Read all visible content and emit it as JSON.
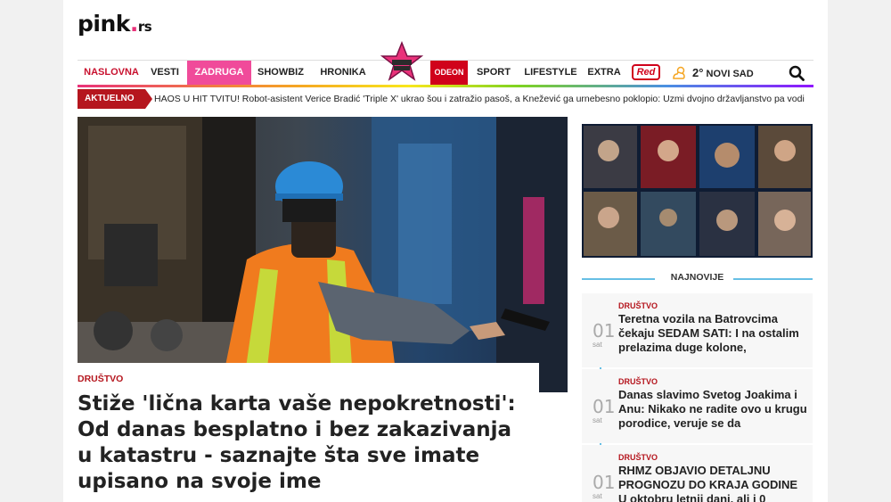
{
  "logo": {
    "name": "pink",
    "dot": ".",
    "tld": "rs"
  },
  "nav": {
    "items": [
      "NASLOVNA",
      "VESTI",
      "ZADRUGA",
      "SHOWBIZ",
      "HRONIKA",
      "SPORT",
      "LIFESTYLE",
      "EXTRA"
    ],
    "odeon": "ODEON",
    "red": "Red",
    "weather": {
      "temp": "2°",
      "city": "NOVI SAD"
    }
  },
  "ticker": {
    "label": "AKTUELNO",
    "text": "HAOS U HIT TVITU! Robot-asistent Verice Bradić 'Triple X' ukrao šou i zatražio pasoš, a Knežević ga urnebesno poklopio: Uzmi dvojno državljanstvo pa vodi"
  },
  "hero": {
    "category": "DRUŠTVO",
    "headline": "Stiže 'lična karta vaše nepokretnosti': Od danas besplatno i bez zakazivanja u katastru - saznajte šta sve imate upisano na svoje ime"
  },
  "sidebar": {
    "section_title": "NAJNOVIJE",
    "items": [
      {
        "num": "01",
        "unit": "sat",
        "category": "DRUŠTVO",
        "title": "Teretna vozila na Batrovcima čekaju SEDAM SATI: I na ostalim prelazima duge kolone,"
      },
      {
        "num": "01",
        "unit": "sat",
        "category": "DRUŠTVO",
        "title": "Danas slavimo Svetog Joakima i Anu: Nikako ne radite ovo u krugu porodice, veruje se da"
      },
      {
        "num": "01",
        "unit": "sat",
        "category": "DRUŠTVO",
        "title": "RHMZ OBJAVIO DETALJNU PROGNOZU DO KRAJA GODINE U oktobru letnji dani, ali i 0"
      }
    ]
  },
  "colors": {
    "accent": "#b5161e",
    "zadruga": "#f04b9a",
    "najnovije_line": "#66bfe5"
  }
}
